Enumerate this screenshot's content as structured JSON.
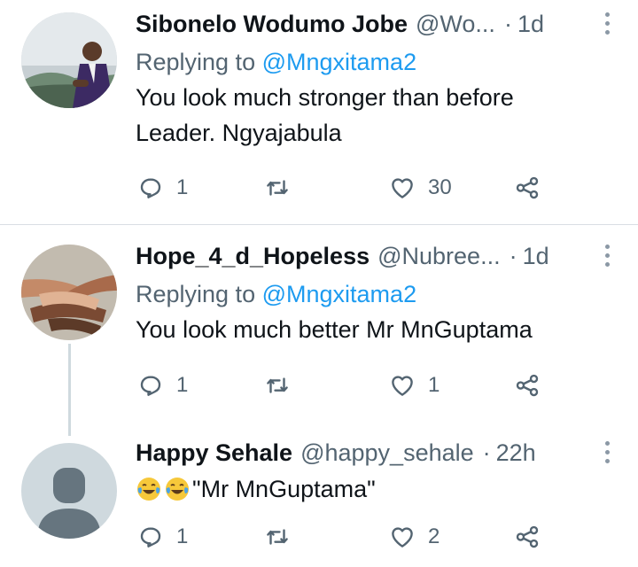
{
  "tweets": [
    {
      "name": "Sibonelo Wodumo Jobe",
      "handle": "@Wo...",
      "dot": "·",
      "time": "1d",
      "replying_prefix": "Replying to",
      "replying_to": "@Mngxitama2",
      "text_lines": [
        "You look much stronger than before",
        "Leader. Ngyajabula"
      ],
      "replies": "1",
      "retweets": "",
      "likes": "30"
    },
    {
      "name": "Hope_4_d_Hopeless",
      "handle": "@Nubree...",
      "dot": "·",
      "time": "1d",
      "replying_prefix": "Replying to",
      "replying_to": "@Mngxitama2",
      "text_lines": [
        "You look much better Mr MnGuptama"
      ],
      "replies": "1",
      "retweets": "",
      "likes": "1"
    },
    {
      "name": "Happy Sehale",
      "handle": "@happy_sehale",
      "dot": "·",
      "time": "22h",
      "text": "\"Mr MnGuptama\"",
      "emojis": [
        "face-with-tears-of-joy",
        "face-with-tears-of-joy"
      ],
      "replies": "1",
      "retweets": "",
      "likes": "2"
    }
  ],
  "colors": {
    "text": "#0f1419",
    "secondary": "#536471",
    "link": "#1d9bf0",
    "divider": "#d9dee3"
  }
}
